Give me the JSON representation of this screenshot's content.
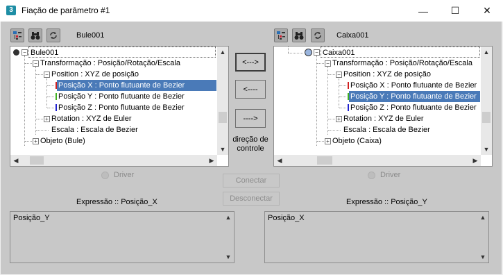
{
  "window": {
    "title": "Fiação de parâmetro #1",
    "app_icon": "3",
    "minimize": "—",
    "maximize": "☐",
    "close": "✕"
  },
  "left": {
    "object_name": "Bule001",
    "tree": [
      "Bule001",
      "Transformação : Posição/Rotação/Escala",
      "Position : XYZ de posição",
      "Posição X : Ponto flutuante de Bezier",
      "Posição Y : Ponto flutuante de Bezier",
      "Posição Z : Ponto flutuante de Bezier",
      "Rotation : XYZ de Euler",
      "Escala : Escala de Bezier",
      "Objeto (Bule)"
    ],
    "selected": "Posição X : Ponto flutuante de Bezier",
    "driver_label": "Driver",
    "expression_label": "Expressão :: Posição_X",
    "expression": "Posição_Y"
  },
  "right": {
    "object_name": "Caixa001",
    "tree": [
      "Caixa001",
      "Transformação : Posição/Rotação/Escala",
      "Position : XYZ de posição",
      "Posição X : Ponto flutuante de Bezier",
      "Posição Y : Ponto flutuante de Bezier",
      "Posição Z : Ponto flutuante de Bezier",
      "Rotation : XYZ de Euler",
      "Escala : Escala de Bezier",
      "Objeto (Caixa)"
    ],
    "selected": "Posição Y : Ponto flutuante de Bezier",
    "driver_label": "Driver",
    "expression_label": "Expressão :: Posição_Y",
    "expression": "Posição_X"
  },
  "middle": {
    "both_ways": "<--->",
    "left_arrow": "<----",
    "right_arrow": "---->",
    "direction_label_1": "direção de",
    "direction_label_2": "controle",
    "connect": "Conectar",
    "disconnect": "Desconectar"
  },
  "colors": {
    "selection": "#4a7ab8",
    "x_axis": "#d02020",
    "y_axis": "#40b020",
    "z_axis": "#2020d0"
  }
}
